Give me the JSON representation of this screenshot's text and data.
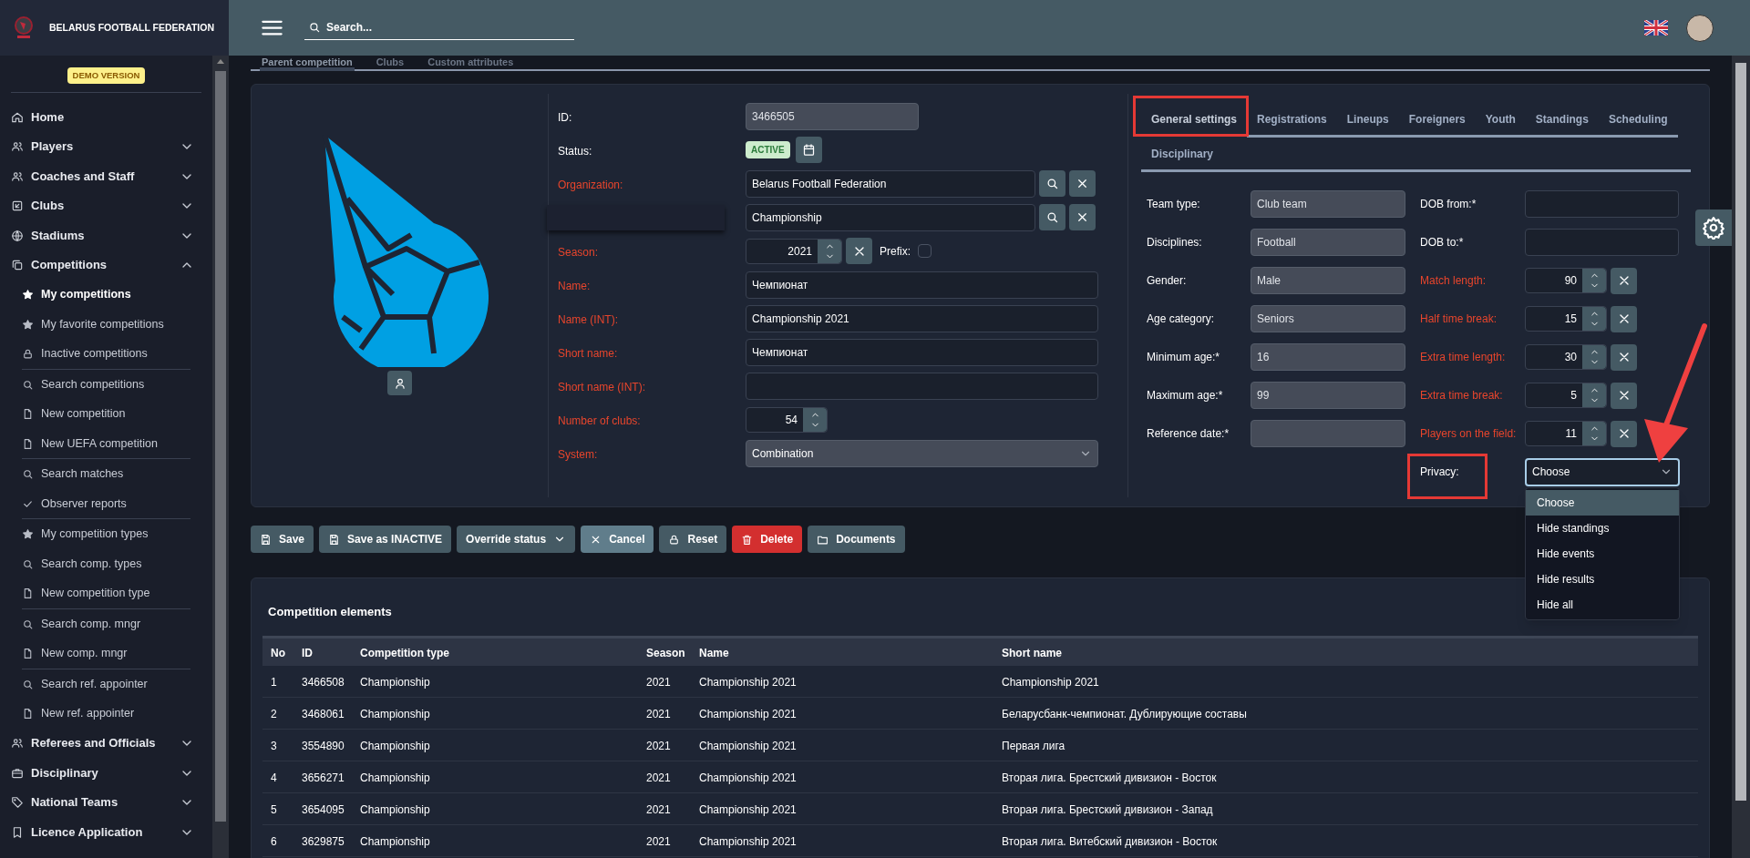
{
  "header": {
    "brand": "BELARUS FOOTBALL FEDERATION",
    "search_placeholder": "Search..."
  },
  "sidebar": {
    "badge": "DEMO VERSION",
    "items": [
      {
        "label": "Home"
      },
      {
        "label": "Players",
        "expanded": false
      },
      {
        "label": "Coaches and Staff",
        "expanded": false
      },
      {
        "label": "Clubs",
        "expanded": false
      },
      {
        "label": "Stadiums",
        "expanded": false
      },
      {
        "label": "Competitions",
        "expanded": true,
        "groups": [
          [
            {
              "label": "My competitions",
              "selected": true
            },
            {
              "label": "My favorite competitions",
              "selected": false
            },
            {
              "label": "Inactive competitions",
              "selected": false
            }
          ],
          [
            {
              "label": "Search competitions",
              "selected": false
            },
            {
              "label": "New competition",
              "selected": false
            },
            {
              "label": "New UEFA competition",
              "selected": false
            }
          ],
          [
            {
              "label": "Search matches",
              "selected": false
            },
            {
              "label": "Observer reports",
              "selected": false
            }
          ],
          [
            {
              "label": "My competition types",
              "selected": false
            },
            {
              "label": "Search comp. types",
              "selected": false
            },
            {
              "label": "New competition type",
              "selected": false
            }
          ],
          [
            {
              "label": "Search comp. mngr",
              "selected": false
            },
            {
              "label": "New comp. mngr",
              "selected": false
            }
          ],
          [
            {
              "label": "Search ref. appointer",
              "selected": false
            },
            {
              "label": "New ref. appointer",
              "selected": false
            }
          ]
        ]
      },
      {
        "label": "Referees and Officials",
        "expanded": false
      },
      {
        "label": "Disciplinary",
        "expanded": false
      },
      {
        "label": "National Teams",
        "expanded": false
      },
      {
        "label": "Licence Application",
        "expanded": false
      }
    ]
  },
  "top_tabs": [
    {
      "label": "Parent competition",
      "selected": true
    },
    {
      "label": "Clubs",
      "selected": false
    },
    {
      "label": "Custom attributes",
      "selected": false
    }
  ],
  "form": [
    {
      "kind": "readonly",
      "label": "ID:",
      "required": false,
      "value": "3466505"
    },
    {
      "kind": "status",
      "label": "Status:",
      "required": false,
      "value": "ACTIVE"
    },
    {
      "kind": "lookup",
      "label": "Organization:",
      "required": true,
      "value": "Belarus Football Federation"
    },
    {
      "kind": "lookup",
      "value": "Championship"
    },
    {
      "kind": "season",
      "label": "Season:",
      "required": true,
      "value": "2021",
      "prefix_label": "Prefix:",
      "prefix_checked": false
    },
    {
      "kind": "text",
      "label": "Name:",
      "required": true,
      "value": "Чемпионат"
    },
    {
      "kind": "text",
      "label": "Name (INT):",
      "required": true,
      "value": "Championship 2021"
    },
    {
      "kind": "text",
      "label": "Short name:",
      "required": true,
      "value": "Чемпионат"
    },
    {
      "kind": "text",
      "label": "Short name (INT):",
      "required": true
    },
    {
      "kind": "number",
      "label": "Number of clubs:",
      "required": true,
      "value": "54"
    },
    {
      "kind": "select",
      "label": "System:",
      "required": true,
      "value": "Combination"
    }
  ],
  "settings_tabs": [
    {
      "label": "General settings",
      "selected": true
    },
    {
      "label": "Registrations",
      "selected": false
    },
    {
      "label": "Lineups",
      "selected": false
    },
    {
      "label": "Foreigners",
      "selected": false
    },
    {
      "label": "Youth",
      "selected": false
    },
    {
      "label": "Standings",
      "selected": false
    },
    {
      "label": "Scheduling",
      "selected": false
    },
    {
      "label": "Disciplinary",
      "selected": false
    }
  ],
  "settings_left": [
    {
      "label": "Team type:",
      "value": "Club team"
    },
    {
      "label": "Disciplines:",
      "value": "Football"
    },
    {
      "label": "Gender:",
      "value": "Male"
    },
    {
      "label": "Age category:",
      "value": "Seniors"
    },
    {
      "label": "Minimum age:*",
      "value": "16"
    },
    {
      "label": "Maximum age:*",
      "value": "99"
    },
    {
      "label": "Reference date:*"
    }
  ],
  "settings_right": [
    {
      "kind": "text",
      "label": "DOB from:*",
      "required": false
    },
    {
      "kind": "text",
      "label": "DOB to:*",
      "required": false
    },
    {
      "kind": "number",
      "label": "Match length:",
      "required": true,
      "value": "90"
    },
    {
      "kind": "number",
      "label": "Half time break:",
      "required": true,
      "value": "15"
    },
    {
      "kind": "number",
      "label": "Extra time length:",
      "required": true,
      "value": "30"
    },
    {
      "kind": "number",
      "label": "Extra time break:",
      "required": true,
      "value": "5"
    },
    {
      "kind": "number",
      "label": "Players on the field:",
      "required": true,
      "value": "11"
    },
    {
      "kind": "select",
      "label": "Privacy:",
      "required": false,
      "value": "Choose",
      "open": true,
      "options": [
        {
          "label": "Choose",
          "selected": true
        },
        {
          "label": "Hide standings",
          "selected": false
        },
        {
          "label": "Hide events",
          "selected": false
        },
        {
          "label": "Hide results",
          "selected": false
        },
        {
          "label": "Hide all",
          "selected": false
        }
      ]
    }
  ],
  "actions": [
    {
      "kind": "default",
      "label": "Save"
    },
    {
      "kind": "default",
      "label": "Save as INACTIVE"
    },
    {
      "kind": "dropdown",
      "label": "Override status"
    },
    {
      "kind": "light",
      "label": "Cancel"
    },
    {
      "kind": "default",
      "label": "Reset"
    },
    {
      "kind": "danger",
      "label": "Delete"
    },
    {
      "kind": "default",
      "label": "Documents"
    }
  ],
  "table": {
    "title": "Competition elements",
    "columns": [
      "No",
      "ID",
      "Competition type",
      "Season",
      "Name",
      "Short name"
    ],
    "rows": [
      [
        "1",
        "3466508",
        "Championship",
        "2021",
        "Championship 2021",
        "Championship 2021"
      ],
      [
        "2",
        "3468061",
        "Championship",
        "2021",
        "Championship 2021",
        "Беларусбанк-чемпионат. Дублирующие составы"
      ],
      [
        "3",
        "3554890",
        "Championship",
        "2021",
        "Championship 2021",
        "Первая лига"
      ],
      [
        "4",
        "3656271",
        "Championship",
        "2021",
        "Championship 2021",
        "Вторая лига. Брестский дивизион - Восток"
      ],
      [
        "5",
        "3654095",
        "Championship",
        "2021",
        "Championship 2021",
        "Вторая лига. Брестский дивизион - Запад"
      ],
      [
        "6",
        "3629875",
        "Championship",
        "2021",
        "Championship 2021",
        "Вторая лига. Витебский дивизион - Восток"
      ]
    ]
  }
}
